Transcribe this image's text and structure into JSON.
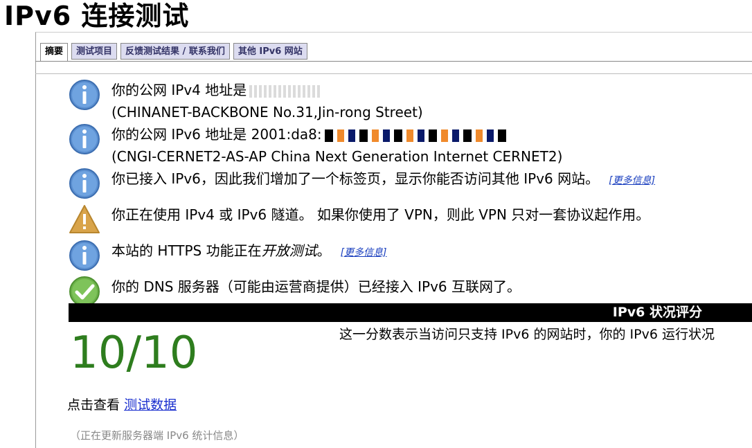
{
  "page": {
    "title": "IPv6 连接测试"
  },
  "tabs": [
    {
      "label": "摘要"
    },
    {
      "label": "测试项目"
    },
    {
      "label": "反馈测试结果 / 联系我们"
    },
    {
      "label": "其他 IPv6 网站"
    }
  ],
  "rows": {
    "ipv4": {
      "line1": "你的公网 IPv4 地址是",
      "line2": "(CHINANET-BACKBONE No.31,Jin-rong Street)"
    },
    "ipv6": {
      "line1": "你的公网 IPv6 地址是 2001:da8:",
      "line2": "(CNGI-CERNET2-AS-AP China Next Generation Internet CERNET2)"
    },
    "tab_added": {
      "text": "你已接入 IPv6，因此我们增加了一个标签页，显示你能否访问其他 IPv6 网站。",
      "more": "[更多信息]"
    },
    "tunnel": {
      "text": "你正在使用 IPv4 或 IPv6 隧道。 如果你使用了 VPN，则此 VPN 只对一套协议起作用。"
    },
    "https": {
      "text_prefix": "本站的 HTTPS 功能正在",
      "text_italic": "开放测试",
      "text_suffix": "。",
      "more": "[更多信息]"
    },
    "dns": {
      "text": "你的 DNS 服务器（可能由运营商提供）已经接入 IPv6 互联网了。"
    }
  },
  "score": {
    "bar_label": "IPv6 状况评分",
    "value": "10/10",
    "description": "这一分数表示当访问只支持 IPv6 的网站时，你的 IPv6 运行状况",
    "color": "#2e7d1e"
  },
  "stats": {
    "prefix": "点击查看",
    "link": "测试数据"
  },
  "footer": {
    "note": "（正在更新服务器端 IPv6 统计信息）"
  },
  "icons": {
    "info": "info-icon",
    "warning": "warning-icon",
    "ok": "checkmark-icon"
  }
}
